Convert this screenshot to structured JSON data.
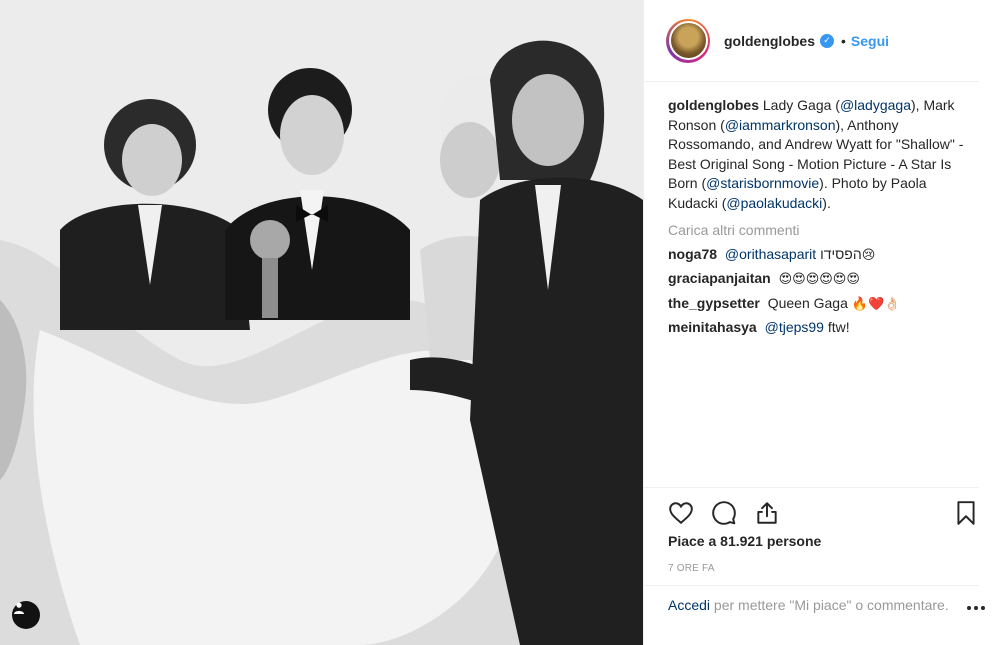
{
  "post": {
    "username": "goldenglobes",
    "follow_label": "Segui",
    "caption_parts": {
      "p1": "Lady Gaga (",
      "m1": "@ladygaga",
      "p2": "), Mark Ronson (",
      "m2": "@iammarkronson",
      "p3": "), Anthony Rossomando, and Andrew Wyatt for \"Shallow\" - Best Original Song - Motion Picture - A Star Is Born (",
      "m3": "@starisbornmovie",
      "p4": "). Photo by Paola Kudacki (",
      "m4": "@paolakudacki",
      "p5": ")."
    },
    "load_more": "Carica altri commenti",
    "comments": [
      {
        "user": "noga78",
        "mention": "@orithasaparit",
        "text": "הפסידו",
        "emoji": "😢"
      },
      {
        "user": "graciapanjaitan",
        "text": "",
        "emoji": "😍😍😍😍😍😍"
      },
      {
        "user": "the_gypsetter",
        "text": "Queen Gaga",
        "emoji": "🔥❤️👌🏻"
      },
      {
        "user": "meinitahasya",
        "mention": "@tjeps99",
        "text": "ftw!"
      }
    ],
    "likes": "Piace a 81.921 persone",
    "time": "7 ORE FA",
    "login_link": "Accedi",
    "login_text": "per mettere \"Mi piace\" o commentare."
  },
  "icons": {
    "like": "heart-icon",
    "comment": "comment-icon",
    "share": "share-icon",
    "save": "bookmark-icon",
    "tag": "user-tag-icon",
    "more": "more-options-icon"
  },
  "colors": {
    "link": "#003569",
    "follow": "#3897f0",
    "muted": "#999999",
    "text": "#262626"
  }
}
